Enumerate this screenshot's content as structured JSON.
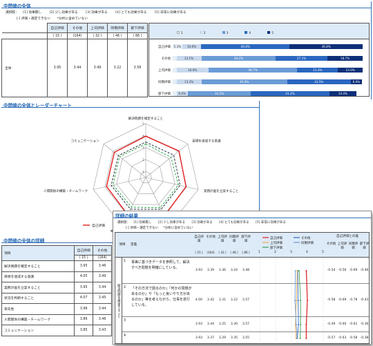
{
  "section1": {
    "title": "中間値の全体",
    "legend_line1": [
      "選択肢：",
      "[1] 効果無し",
      "[2] 少し効果がある",
      "[3] 効果がある",
      "[4] とても効果がある",
      "[5] 非常に効果がある"
    ],
    "legend_line2": [
      "[-] 評価・選定できない",
      "*分析に含めていない"
    ],
    "columns": [
      {
        "label": "自己評価",
        "n": "( 15 )"
      },
      {
        "label": "その他",
        "n": "(164)"
      },
      {
        "label": "上司評価",
        "n": "( 32 )"
      },
      {
        "label": "同僚評価",
        "n": "( 46 )"
      },
      {
        "label": "部下評価",
        "n": "( 86 )"
      }
    ],
    "row_label": "全体",
    "row_values": [
      "3.95",
      "3.44",
      "3.49",
      "3.22",
      "3.58"
    ],
    "bar_legend": [
      "1",
      "2",
      "3",
      "4",
      "5"
    ],
    "bars": [
      {
        "label": "自己評価",
        "segments": [
          {
            "v": 0.05,
            "t": "5.3%"
          },
          {
            "v": 0.1,
            "t": "10.6%"
          },
          {
            "v": 0.0,
            "t": ""
          },
          {
            "v": 0.465,
            "t": "46.8%"
          },
          {
            "v": 0.385,
            "t": "36.8%"
          }
        ]
      },
      {
        "label": "その他",
        "segments": [
          {
            "v": 0.02,
            "t": ""
          },
          {
            "v": 0.131,
            "t": "13.1%"
          },
          {
            "v": 0.392,
            "t": "39.2%"
          },
          {
            "v": 0.271,
            "t": "27.1%"
          },
          {
            "v": 0.187,
            "t": "18.7%"
          }
        ]
      },
      {
        "label": "上司評価",
        "segments": [
          {
            "v": 0.02,
            "t": ""
          },
          {
            "v": 0.169,
            "t": "16.9%"
          },
          {
            "v": 0.467,
            "t": "46.7%"
          },
          {
            "v": 0.214,
            "t": "21.4%"
          },
          {
            "v": 0.13,
            "t": "13.0%"
          }
        ]
      },
      {
        "label": "同僚評価",
        "segments": [
          {
            "v": 0.02,
            "t": ""
          },
          {
            "v": 0.132,
            "t": "13.2%"
          },
          {
            "v": 0.45,
            "t": "45.0%"
          },
          {
            "v": 0.335,
            "t": "33.5%"
          },
          {
            "v": 0.06,
            "t": "6.0%"
          }
        ]
      },
      {
        "label": "部下評価",
        "segments": [
          {
            "v": 0.02,
            "t": ""
          },
          {
            "v": 0.06,
            "t": "6.0%"
          },
          {
            "v": 0.332,
            "t": "33.2%"
          },
          {
            "v": 0.412,
            "t": "41.2%"
          },
          {
            "v": 0.144,
            "t": "14.4%"
          }
        ]
      }
    ],
    "bar_colors": [
      "#e6eef8",
      "#c7d8ee",
      "#6b9bd6",
      "#2a67c0",
      "#0e2f78"
    ]
  },
  "section2": {
    "title": "中間値の全体とレーダーチャート",
    "axes": [
      "解決問題を確定すること",
      "目標を達成する意識",
      "実務計画を立案すること",
      "状況を判断すること",
      "率先性",
      "人間関係の構築・チームワーク",
      "コミュニケーション"
    ],
    "scale_labels": [
      "1",
      "2",
      "3",
      "4",
      "5"
    ],
    "series": [
      {
        "name": "自己評価",
        "color": "#e21f1f",
        "values": [
          3.95,
          4.05,
          3.95,
          4.07,
          3.96,
          3.86,
          3.86
        ]
      },
      {
        "name": "その他",
        "color": "#1f2a3a",
        "values": [
          3.46,
          3.49,
          3.44,
          3.45,
          3.44,
          3.46,
          3.43
        ]
      },
      {
        "name": "上司評価",
        "color": "#2aa84a",
        "values": [
          3.3,
          3.2,
          3.3,
          3.3,
          3.25,
          3.3,
          3.3
        ]
      }
    ],
    "legend_visible": "自己評価"
  },
  "section3": {
    "title": "中間値の全体の詳細",
    "col_item": "項目",
    "columns": [
      {
        "label": "自己評価",
        "n": "( 15 )"
      },
      {
        "label": "その他",
        "n": "(164)"
      }
    ],
    "rows": [
      {
        "label": "解決問題を確定すること",
        "v": [
          "3.95",
          "3.46"
        ]
      },
      {
        "label": "目標を達成する意識",
        "v": [
          "4.05",
          "3.49"
        ]
      },
      {
        "label": "実務計画を立案すること",
        "v": [
          "3.95",
          "3.44"
        ]
      },
      {
        "label": "状況を判断すること",
        "v": [
          "4.07",
          "3.45"
        ]
      },
      {
        "label": "率先性",
        "v": [
          "3.96",
          "3.44"
        ]
      },
      {
        "label": "人間関係の構築・チームワーク",
        "v": [
          "3.86",
          "3.46"
        ]
      },
      {
        "label": "コミュニケーション",
        "v": [
          "3.85",
          "3.43"
        ]
      }
    ]
  },
  "detail": {
    "title": "詳細の結果",
    "legend_line1": [
      "選択肢：",
      "[1] 効果無し",
      "[2] 少し効果がある",
      "[3] 効果がある",
      "[4] とても効果がある",
      "[5] 非常に効果がある"
    ],
    "legend_line2": [
      "[-] 評価・選定できない",
      "*分析に含めていない"
    ],
    "side_label": "解決問題を確定すること",
    "col_no": "項目",
    "col_def": "定義",
    "score_cols": [
      {
        "label": "自己評価",
        "n": "( 15 )"
      },
      {
        "label": "その他",
        "n": "(164)"
      },
      {
        "label": "上司評価",
        "n": "( 32 )"
      },
      {
        "label": "同僚評価",
        "n": "( 46 )"
      },
      {
        "label": "部下評価",
        "n": "( 86 )"
      }
    ],
    "scale": [
      "1",
      "2",
      "3",
      "4",
      "5"
    ],
    "line_legend": [
      {
        "name": "自己評価",
        "color": "#e21f1f"
      },
      {
        "name": "その他",
        "color": "#2a67c0"
      },
      {
        "name": "上司評価",
        "color": "#f1a94b"
      },
      {
        "name": "同僚評価",
        "color": "#6b9bd6"
      },
      {
        "name": "部下評価",
        "color": "#3a9a54"
      }
    ],
    "diff_header": "自己評価との差",
    "diff_cols": [
      "その他",
      "上司評価",
      "同僚評価",
      "部下評価"
    ],
    "rows": [
      {
        "no": "1",
        "text": "事実に基づきデータを参照して、解決すべき問題を明確にしている。",
        "scores": [
          "3.93",
          "3.39",
          "3.36",
          "3.24",
          "3.48"
        ],
        "diffs": [
          "-0.54",
          "-0.56",
          "-0.69",
          "-0.46"
        ],
        "self": 3.93,
        "others": [
          3.39,
          3.36,
          3.24,
          3.48
        ]
      },
      {
        "no": "2",
        "text": "「その方法で困るのか」「何かの問題があるのか」や「もっと良いやり方があるのか」等を考えながら、仕事を遂行している。",
        "scores": [
          "4.00",
          "3.42",
          "3.31",
          "3.22",
          "3.57"
        ],
        "diffs": [
          "-0.58",
          "-0.69",
          "-0.78",
          "-0.43"
        ],
        "self": 4.0,
        "others": [
          3.42,
          3.31,
          3.22,
          3.57
        ]
      },
      {
        "no": "3",
        "text": "",
        "scores": [
          "3.93",
          "3.44",
          "3.25",
          "3.30",
          "3.57"
        ],
        "diffs": [
          "-0.49",
          "-0.60",
          "-0.61",
          "-0.36"
        ],
        "self": 3.93,
        "others": [
          3.44,
          3.25,
          3.3,
          3.57
        ]
      },
      {
        "no": "4",
        "text": "",
        "scores": [
          "3.93",
          "3.37",
          "3.29",
          "3.35",
          "3.55"
        ],
        "diffs": [
          "-0.57",
          "-0.63",
          "-0.58",
          "-0.38"
        ],
        "self": 3.93,
        "others": [
          3.37,
          3.29,
          3.35,
          3.55
        ]
      }
    ]
  },
  "chart_data": [
    {
      "type": "bar",
      "title": "",
      "categories": [
        "自己評価",
        "その他",
        "上司評価",
        "同僚評価",
        "部下評価"
      ],
      "series": [
        {
          "name": "1",
          "values": [
            5.3,
            2,
            2,
            2,
            2
          ]
        },
        {
          "name": "2",
          "values": [
            10.6,
            13.1,
            16.9,
            13.2,
            6.0
          ]
        },
        {
          "name": "3",
          "values": [
            0,
            39.2,
            46.7,
            45.0,
            33.2
          ]
        },
        {
          "name": "4",
          "values": [
            46.8,
            27.1,
            21.4,
            33.5,
            41.2
          ]
        },
        {
          "name": "5",
          "values": [
            36.8,
            18.7,
            13.0,
            6.0,
            14.4
          ]
        }
      ],
      "stacked": true,
      "orientation": "horizontal"
    },
    {
      "type": "radar",
      "title": "",
      "categories": [
        "解決問題を確定すること",
        "目標を達成する意識",
        "実務計画を立案すること",
        "状況を判断すること",
        "率先性",
        "人間関係の構築・チームワーク",
        "コミュニケーション"
      ],
      "series": [
        {
          "name": "自己評価",
          "values": [
            3.95,
            4.05,
            3.95,
            4.07,
            3.96,
            3.86,
            3.86
          ]
        },
        {
          "name": "その他",
          "values": [
            3.46,
            3.49,
            3.44,
            3.45,
            3.44,
            3.46,
            3.43
          ]
        }
      ],
      "range": [
        1,
        5
      ]
    }
  ]
}
